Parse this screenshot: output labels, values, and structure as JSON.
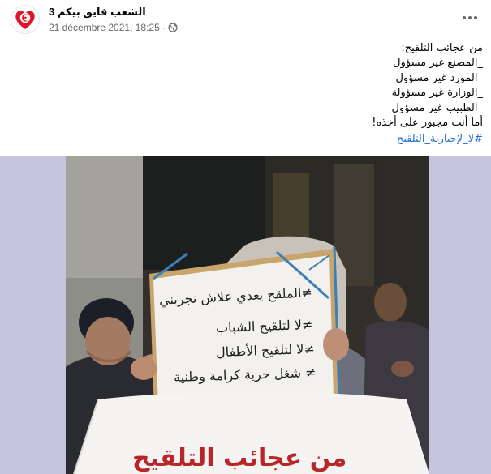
{
  "post": {
    "author": "الشعب فايق بيكم 3",
    "timestamp": "21 décembre 2021, 18:25",
    "separator": "·",
    "privacy_icon": "globe-icon",
    "more_icon": "more-options-icon",
    "body_lines": [
      "من عجائب التلقيح:",
      "_المصنع غير مسؤول",
      "_المورد غير مسؤول",
      "_الوزارة غير مسؤولة",
      "_الطبيب غير مسؤول",
      "أما أنت مجبور على أخذه!"
    ],
    "hashtag": "#لا_لإجبارية_التلقيح"
  },
  "photo": {
    "sign_lines": [
      "≠الملقح يعدي علاش تجربني",
      "≠لا لتلقيح الشباب",
      "≠لا لتلقيح الأطفال",
      "≠ شغل حرية كرامة وطنية"
    ],
    "banner": "من عجائب التلقيح"
  },
  "colors": {
    "link": "#216fdb",
    "secondary_text": "#65676b",
    "media_background": "#c5c4dc",
    "banner_text": "#b8262a"
  }
}
